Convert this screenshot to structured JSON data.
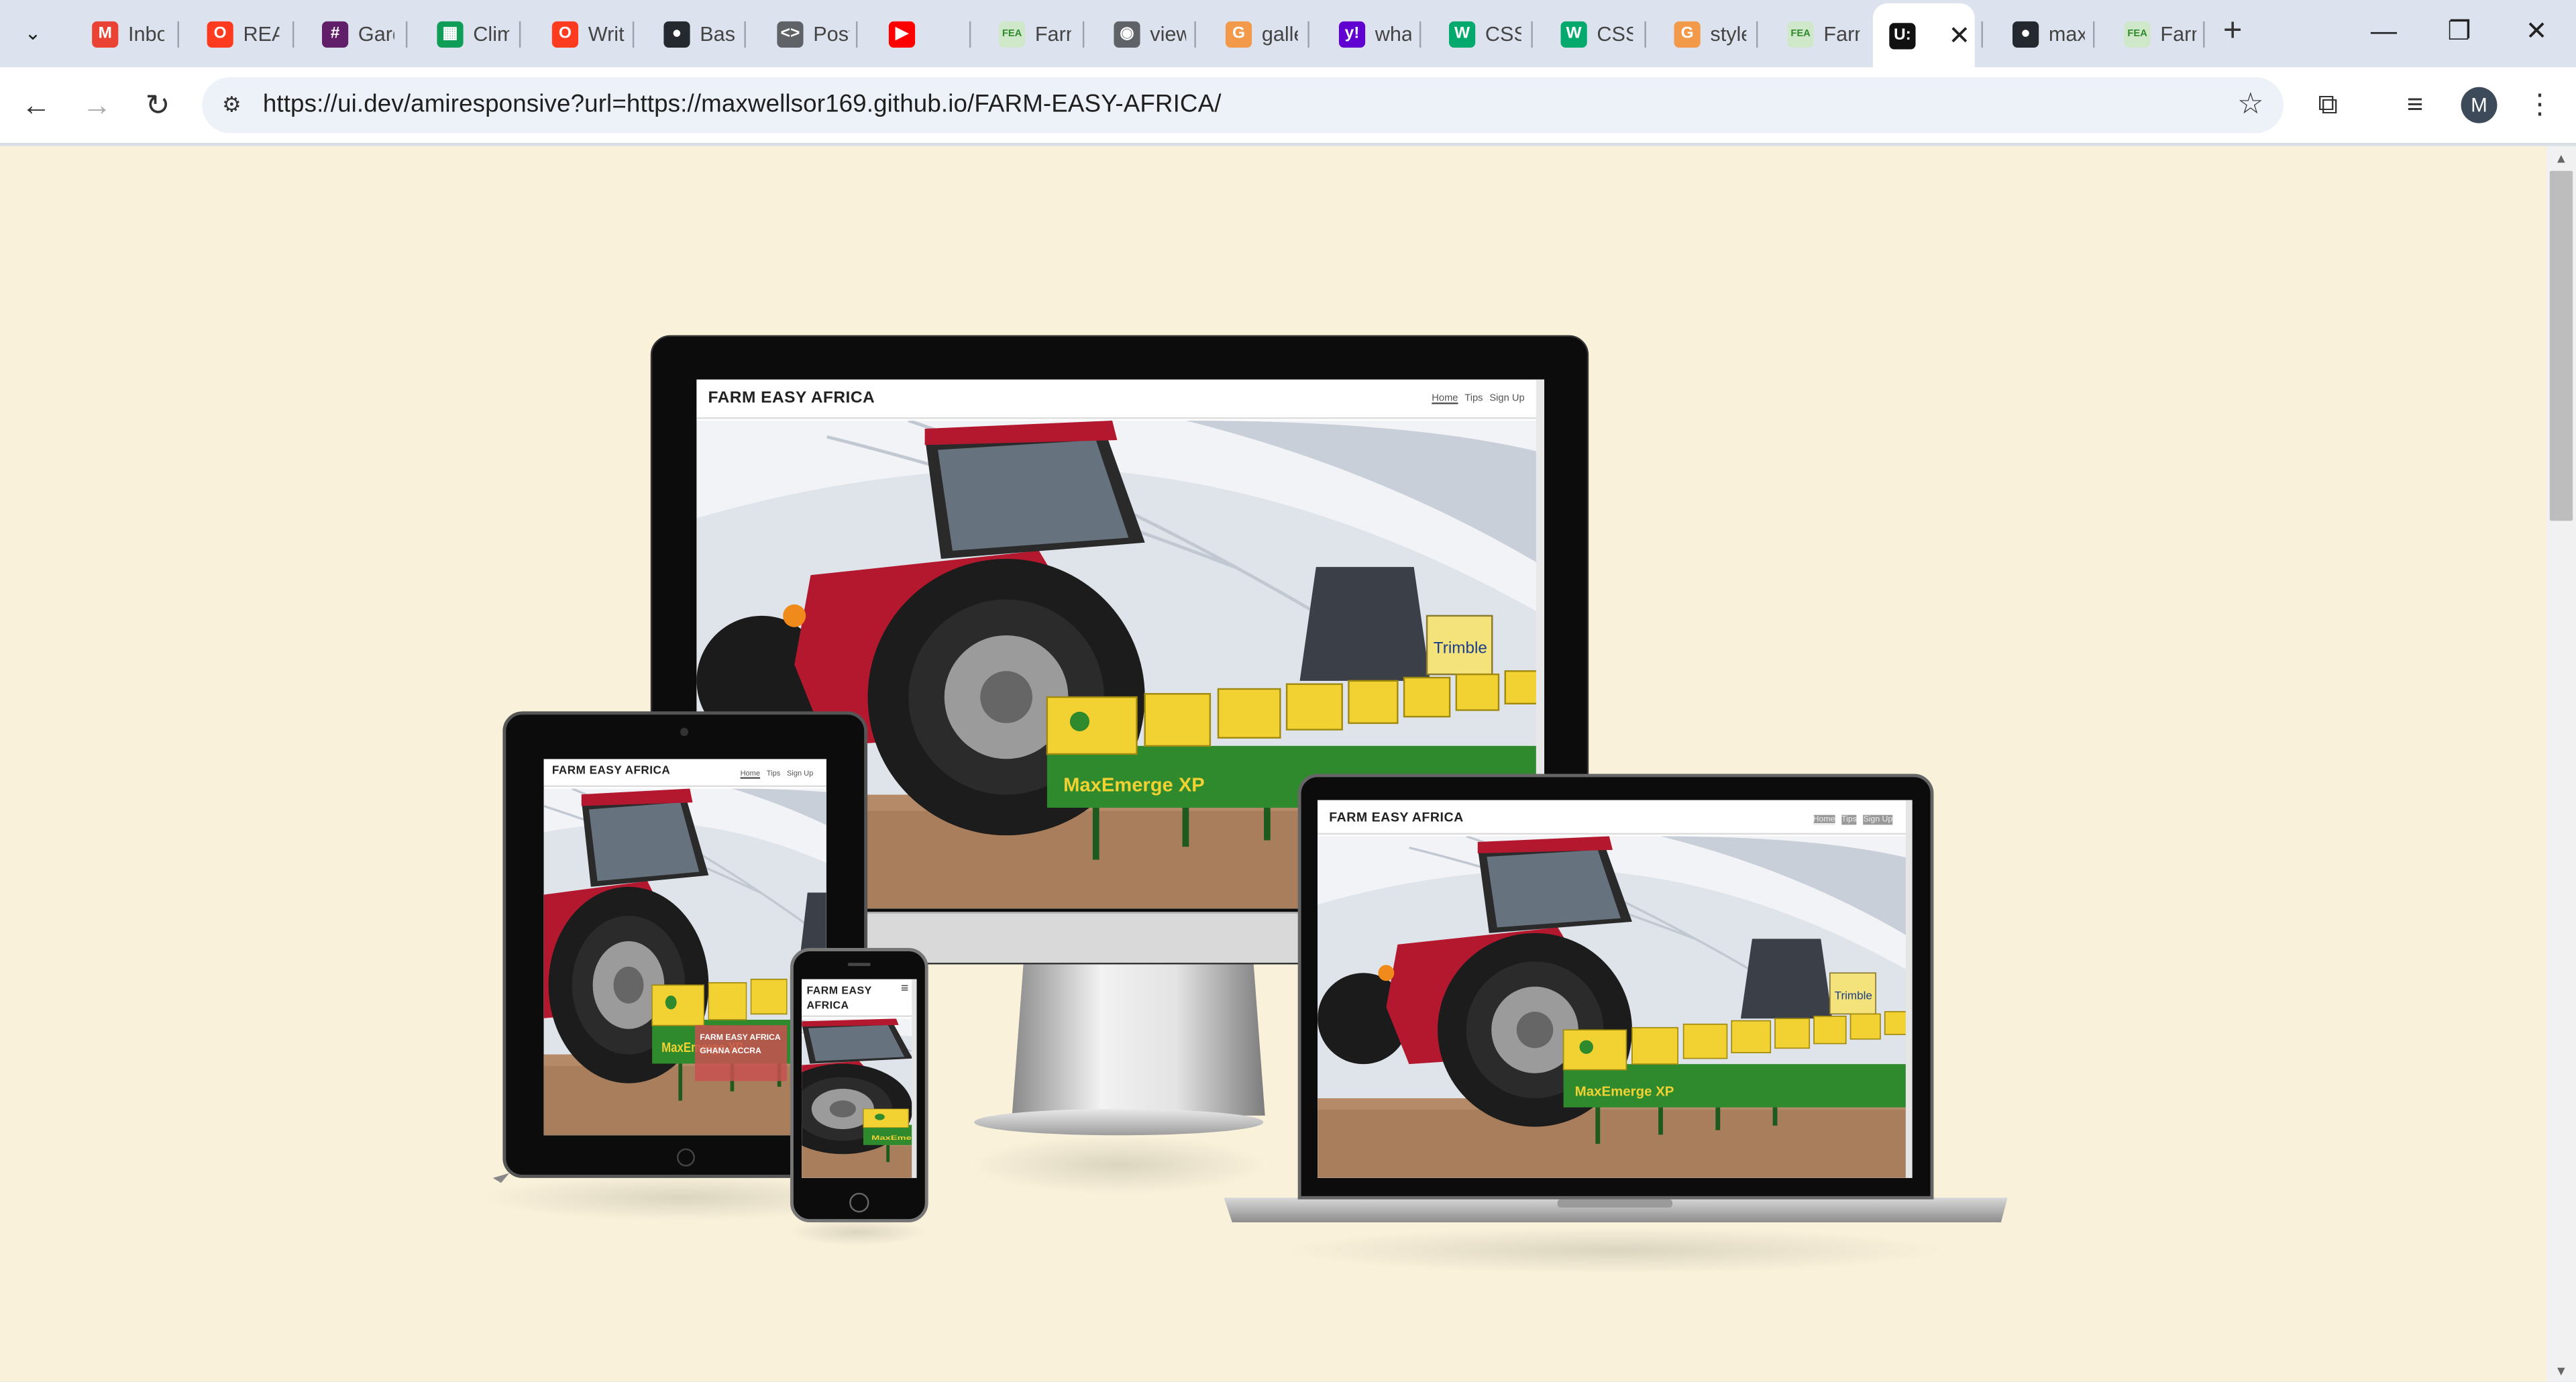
{
  "browser": {
    "tabs": [
      {
        "title": "Inbox",
        "icon": "gmail-icon",
        "color": "#ea4335",
        "glyph": "M"
      },
      {
        "title": "README",
        "icon": "opera-icon",
        "color": "#ff3b1f",
        "glyph": "O"
      },
      {
        "title": "Garden",
        "icon": "slack-icon",
        "color": "#611f69",
        "glyph": "#"
      },
      {
        "title": "Climate",
        "icon": "sheets-icon",
        "color": "#0f9d58",
        "glyph": "▦"
      },
      {
        "title": "Write",
        "icon": "opera-icon",
        "color": "#ff3b1f",
        "glyph": "O"
      },
      {
        "title": "Basic",
        "icon": "github-icon",
        "color": "#24292f",
        "glyph": "●"
      },
      {
        "title": "Post",
        "icon": "code-icon",
        "color": "#5f6368",
        "glyph": "<>"
      },
      {
        "title": "",
        "icon": "youtube-icon",
        "color": "#ff0000",
        "glyph": "▶"
      },
      {
        "title": "Farm",
        "icon": "fea-icon",
        "color": "#cfe8c9",
        "glyph": "FEA"
      },
      {
        "title": "view",
        "icon": "globe-icon",
        "color": "#5f6368",
        "glyph": "◉"
      },
      {
        "title": "gallery",
        "icon": "g-icon",
        "color": "#f2994a",
        "glyph": "G"
      },
      {
        "title": "what",
        "icon": "yahoo-icon",
        "color": "#6001d2",
        "glyph": "y!"
      },
      {
        "title": "CSS",
        "icon": "w3-icon",
        "color": "#04aa6d",
        "glyph": "W"
      },
      {
        "title": "CSS",
        "icon": "w3-icon",
        "color": "#04aa6d",
        "glyph": "W"
      },
      {
        "title": "style",
        "icon": "g-icon",
        "color": "#f2994a",
        "glyph": "G"
      },
      {
        "title": "Farm",
        "icon": "fea-icon",
        "color": "#cfe8c9",
        "glyph": "FEA"
      },
      {
        "title": "",
        "icon": "uidev-icon",
        "color": "#111111",
        "glyph": "U:",
        "active": true
      },
      {
        "title": "max",
        "icon": "github-icon",
        "color": "#24292f",
        "glyph": "●"
      },
      {
        "title": "Farm",
        "icon": "fea-icon",
        "color": "#cfe8c9",
        "glyph": "FEA"
      }
    ],
    "url": "https://ui.dev/amiresponsive?url=https://maxwellsor169.github.io/FARM-EASY-AFRICA/",
    "profile_initial": "M"
  },
  "site": {
    "logo": "FARM EASY AFRICA",
    "logo_line1": "FARM EASY",
    "logo_line2": "AFRICA",
    "nav": {
      "home": "Home",
      "tips": "Tips",
      "signup": "Sign Up"
    },
    "hero_text": "FARM EASY AFRICA",
    "hero_sub": "GHANA ACCRA",
    "brand_text": "MaxEmerge XP",
    "trimble": "Trimble"
  },
  "colors": {
    "page_bg": "#f9f1da",
    "tractor_red": "#b3182f",
    "hopper_yellow": "#f2d233",
    "frame_green": "#2f8a2e"
  }
}
